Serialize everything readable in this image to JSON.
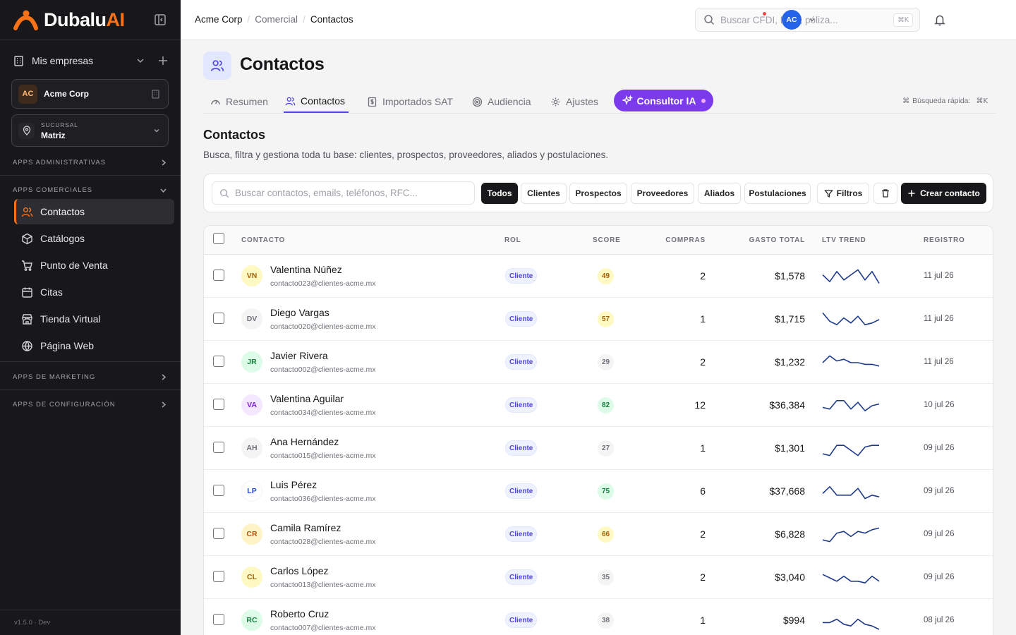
{
  "brand": {
    "name": "Dubalu",
    "suffix": "AI",
    "accent": "#f97316"
  },
  "sidebar": {
    "my_companies": "Mis empresas",
    "company": {
      "initials": "AC",
      "name": "Acme Corp"
    },
    "branch": {
      "label": "SUCURSAL",
      "name": "Matriz"
    },
    "sections": {
      "admin": "APPS ADMINISTRATIVAS",
      "commercial": "APPS COMERCIALES",
      "marketing": "APPS DE MARKETING",
      "config": "APPS DE CONFIGURACIÓN"
    },
    "items": [
      {
        "label": "Contactos",
        "icon": "users-icon",
        "active": true
      },
      {
        "label": "Catálogos",
        "icon": "box-icon"
      },
      {
        "label": "Punto de Venta",
        "icon": "cart-icon"
      },
      {
        "label": "Citas",
        "icon": "calendar-icon"
      },
      {
        "label": "Tienda Virtual",
        "icon": "store-icon"
      },
      {
        "label": "Página Web",
        "icon": "globe-icon"
      }
    ],
    "version": "v1.5.0 · Dev"
  },
  "topbar": {
    "breadcrumb": [
      "Acme Corp",
      "Comercial",
      "Contactos"
    ],
    "search_placeholder": "Buscar CFDI, RFC, póliza...",
    "search_shortcut": "⌘K",
    "user_initials": "AC"
  },
  "page": {
    "title": "Contactos",
    "tabs": [
      {
        "label": "Resumen",
        "icon": "gauge-icon"
      },
      {
        "label": "Contactos",
        "icon": "users-icon",
        "active": true
      },
      {
        "label": "Importados SAT",
        "icon": "file-dollar-icon"
      },
      {
        "label": "Audiencia",
        "icon": "target-icon"
      },
      {
        "label": "Ajustes",
        "icon": "gear-icon"
      }
    ],
    "ai_tab": "Consultor IA",
    "quick_search_label": "Búsqueda rápida:",
    "quick_search_key": "⌘K",
    "section_title": "Contactos",
    "section_desc": "Busca, filtra y gestiona toda tu base: clientes, prospectos, proveedores, aliados y postulaciones."
  },
  "toolbar": {
    "search_placeholder": "Buscar contactos, emails, teléfonos, RFC...",
    "filters": [
      "Todos",
      "Clientes",
      "Prospectos",
      "Proveedores",
      "Aliados",
      "Postulaciones"
    ],
    "filters_label": "Filtros",
    "create_label": "Crear contacto"
  },
  "table": {
    "headers": {
      "contact": "CONTACTO",
      "role": "ROL",
      "score": "SCORE",
      "purchases": "COMPRAS",
      "total": "GASTO TOTAL",
      "ltv": "LTV TREND",
      "registered": "REGISTRO"
    },
    "rows": [
      {
        "initials": "VN",
        "name": "Valentina Núñez",
        "email": "contacto023@clientes-acme.mx",
        "role": "Cliente",
        "score": "49",
        "purchases": "2",
        "total": "$1,578",
        "trend": [
          6,
          2,
          8,
          3,
          6,
          9,
          3,
          8,
          1
        ],
        "registered": "11 jul 26"
      },
      {
        "initials": "DV",
        "name": "Diego Vargas",
        "email": "contacto020@clientes-acme.mx",
        "role": "Cliente",
        "score": "57",
        "purchases": "1",
        "total": "$1,715",
        "trend": [
          9,
          4,
          2,
          6,
          3,
          7,
          2,
          3,
          5
        ],
        "registered": "11 jul 26"
      },
      {
        "initials": "JR",
        "name": "Javier Rivera",
        "email": "contacto002@clientes-acme.mx",
        "role": "Cliente",
        "score": "29",
        "purchases": "2",
        "total": "$1,232",
        "trend": [
          5,
          9,
          6,
          7,
          5,
          5,
          4,
          4,
          3
        ],
        "registered": "11 jul 26"
      },
      {
        "initials": "VA",
        "name": "Valentina Aguilar",
        "email": "contacto034@clientes-acme.mx",
        "role": "Cliente",
        "score": "82",
        "purchases": "12",
        "total": "$36,384",
        "trend": [
          4,
          3,
          8,
          8,
          3,
          7,
          2,
          5,
          6
        ],
        "registered": "10 jul 26"
      },
      {
        "initials": "AH",
        "name": "Ana Hernández",
        "email": "contacto015@clientes-acme.mx",
        "role": "Cliente",
        "score": "27",
        "purchases": "1",
        "total": "$1,301",
        "trend": [
          2,
          1,
          7,
          7,
          4,
          1,
          6,
          7,
          7
        ],
        "registered": "09 jul 26"
      },
      {
        "initials": "LP",
        "name": "Luis Pérez",
        "email": "contacto036@clientes-acme.mx",
        "role": "Cliente",
        "score": "75",
        "purchases": "6",
        "total": "$37,668",
        "trend": [
          4,
          8,
          3,
          3,
          3,
          7,
          1,
          3,
          2
        ],
        "registered": "09 jul 26"
      },
      {
        "initials": "CR",
        "name": "Camila Ramírez",
        "email": "contacto028@clientes-acme.mx",
        "role": "Cliente",
        "score": "66",
        "purchases": "2",
        "total": "$6,828",
        "trend": [
          2,
          1,
          6,
          7,
          4,
          7,
          6,
          8,
          9
        ],
        "registered": "09 jul 26"
      },
      {
        "initials": "CL",
        "name": "Carlos López",
        "email": "contacto013@clientes-acme.mx",
        "role": "Cliente",
        "score": "35",
        "purchases": "2",
        "total": "$3,040",
        "trend": [
          7,
          5,
          3,
          6,
          3,
          3,
          2,
          6,
          3
        ],
        "registered": "09 jul 26"
      },
      {
        "initials": "RC",
        "name": "Roberto Cruz",
        "email": "contacto007@clientes-acme.mx",
        "role": "Cliente",
        "score": "38",
        "purchases": "1",
        "total": "$994",
        "trend": [
          4,
          4,
          6,
          3,
          2,
          6,
          3,
          2,
          0
        ],
        "registered": "08 jul 26"
      }
    ]
  }
}
